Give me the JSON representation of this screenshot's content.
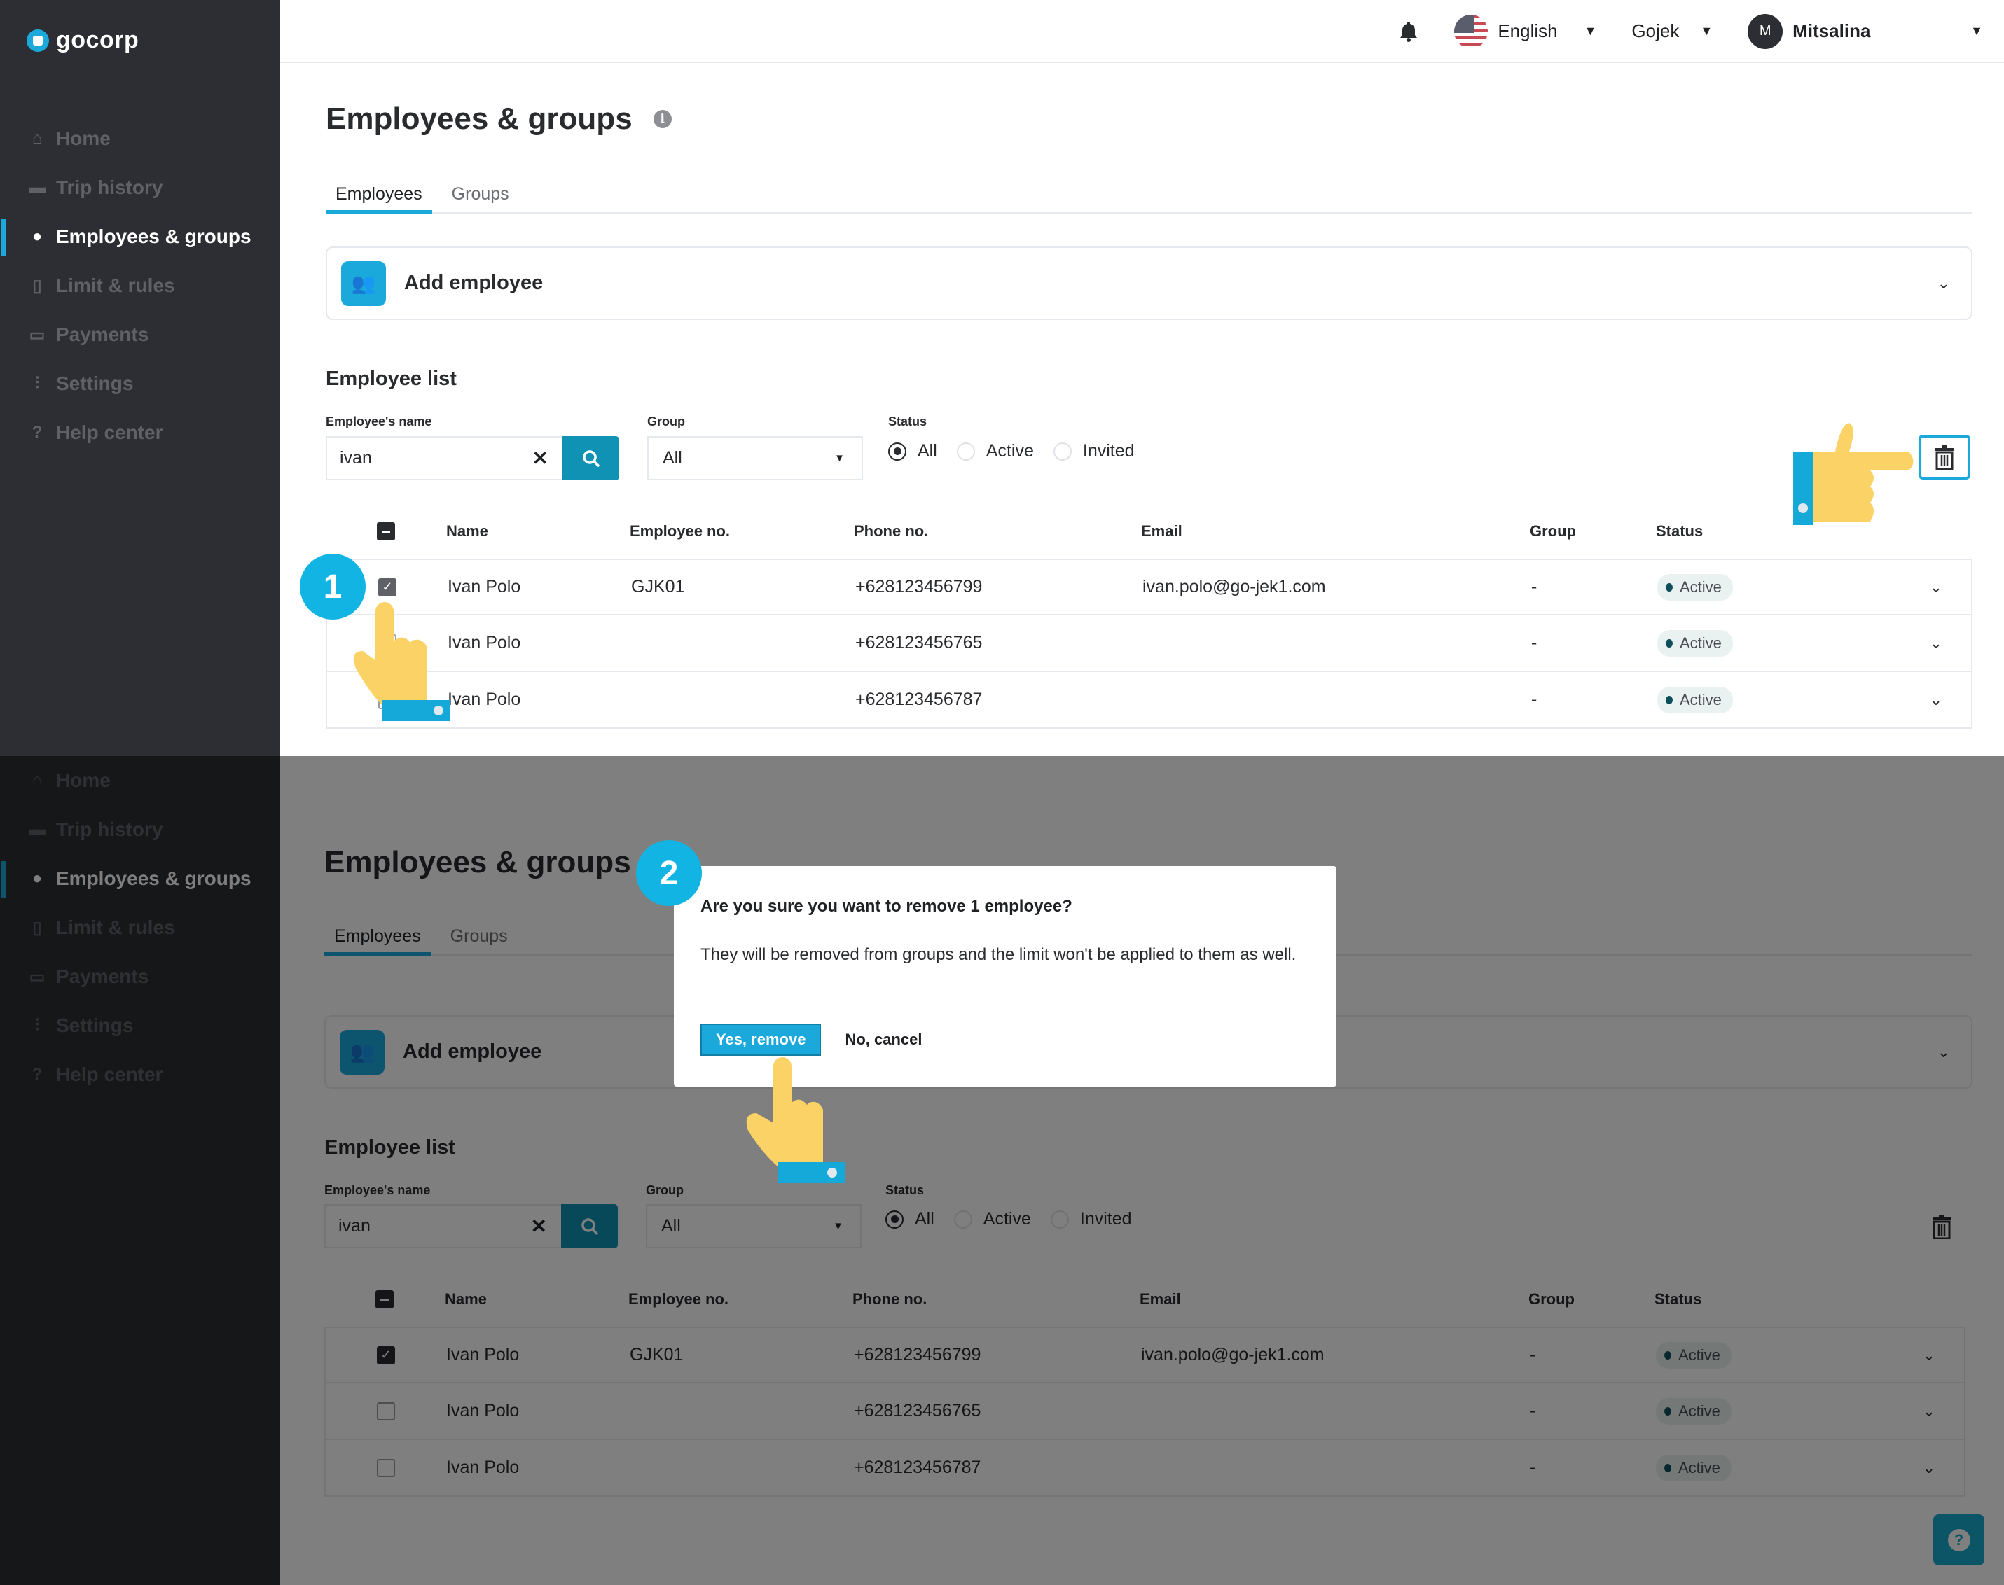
{
  "app": {
    "brand": "gocorp",
    "brand_color": "#1ba9dc"
  },
  "sidebar": {
    "items": [
      {
        "label": "Home",
        "icon": "home-icon",
        "active": false
      },
      {
        "label": "Trip history",
        "icon": "car-icon",
        "active": false
      },
      {
        "label": "Employees & groups",
        "icon": "user-circle-icon",
        "active": true
      },
      {
        "label": "Limit & rules",
        "icon": "document-icon",
        "active": false
      },
      {
        "label": "Payments",
        "icon": "credit-card-icon",
        "active": false
      },
      {
        "label": "Settings",
        "icon": "sliders-icon",
        "active": false
      },
      {
        "label": "Help center",
        "icon": "question-circle-icon",
        "active": false
      }
    ]
  },
  "topbar": {
    "language": "English",
    "company": "Gojek",
    "user_initial": "M",
    "user_name": "Mitsalina"
  },
  "page": {
    "title": "Employees & groups",
    "info_icon": "i",
    "tabs": [
      {
        "label": "Employees",
        "active": true
      },
      {
        "label": "Groups",
        "active": false
      }
    ],
    "add_employee_label": "Add employee",
    "employee_list_title": "Employee list"
  },
  "filters": {
    "name_label": "Employee's name",
    "name_value": "ivan",
    "group_label": "Group",
    "group_value": "All",
    "status_label": "Status",
    "status_options": [
      {
        "label": "All",
        "selected": true
      },
      {
        "label": "Active",
        "selected": false
      },
      {
        "label": "Invited",
        "selected": false
      }
    ]
  },
  "table": {
    "columns": [
      "Name",
      "Employee no.",
      "Phone no.",
      "Email",
      "Group",
      "Status"
    ],
    "rows": [
      {
        "checked": true,
        "name": "Ivan Polo",
        "employee_no": "GJK01",
        "phone": "+628123456799",
        "email": "ivan.polo@go-jek1.com",
        "group": "-",
        "status": "Active"
      },
      {
        "checked": false,
        "name": "Ivan Polo",
        "employee_no": "",
        "phone": "+628123456765",
        "email": "",
        "group": "-",
        "status": "Active"
      },
      {
        "checked": false,
        "name": "Ivan Polo",
        "employee_no": "",
        "phone": "+628123456787",
        "email": "",
        "group": "-",
        "status": "Active"
      }
    ]
  },
  "steps": {
    "one": "1",
    "two": "2"
  },
  "dialog": {
    "title": "Are you sure you want to remove 1 employee?",
    "body": "They will be removed from groups and the limit won't be applied to them as well.",
    "confirm_label": "Yes, remove",
    "cancel_label": "No, cancel"
  },
  "help_fab": {
    "icon": "?"
  }
}
